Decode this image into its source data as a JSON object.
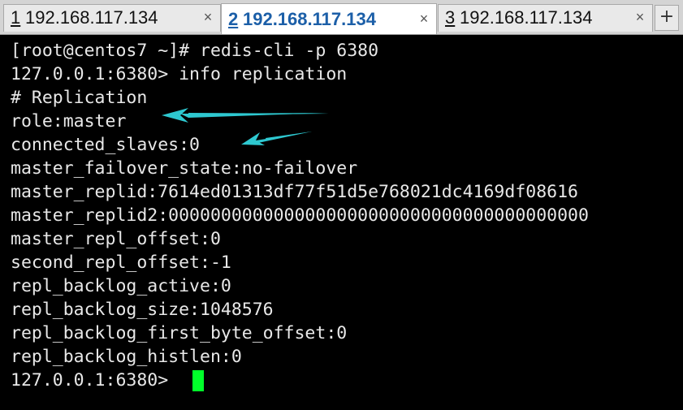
{
  "tabs": [
    {
      "index": "1",
      "label": "192.168.117.134",
      "close": "×",
      "active": false
    },
    {
      "index": "2",
      "label": "192.168.117.134",
      "close": "×",
      "active": true
    },
    {
      "index": "3",
      "label": "192.168.117.134",
      "close": "×",
      "active": false
    }
  ],
  "new_tab_label": "+",
  "terminal": {
    "lines": [
      "[root@centos7 ~]# redis-cli -p 6380",
      "127.0.0.1:6380> info replication",
      "# Replication",
      "role:master",
      "connected_slaves:0",
      "master_failover_state:no-failover",
      "master_replid:7614ed01313df77f51d5e768021dc4169df08616",
      "master_replid2:0000000000000000000000000000000000000000",
      "master_repl_offset:0",
      "second_repl_offset:-1",
      "repl_backlog_active:0",
      "repl_backlog_size:1048576",
      "repl_backlog_first_byte_offset:0",
      "repl_backlog_histlen:0",
      "127.0.0.1:6380> "
    ]
  },
  "colors": {
    "cursor": "#00ff2a",
    "annotation_arrow": "#2ec8d0",
    "terminal_bg": "#000000",
    "terminal_fg": "#e8e8e8",
    "active_tab_text": "#1c5fa8"
  }
}
